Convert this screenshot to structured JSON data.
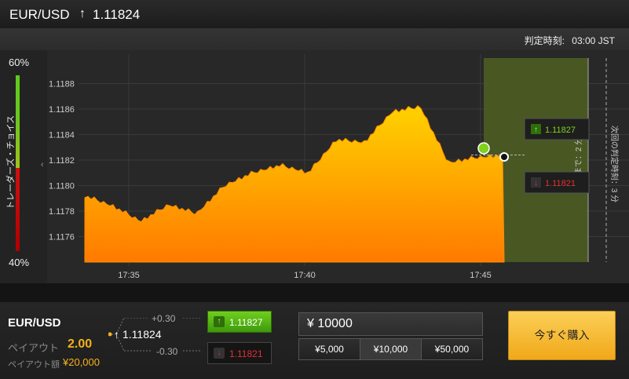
{
  "header": {
    "pair": "EUR/USD",
    "arrow": "↑",
    "price": "1.11824"
  },
  "expiry": {
    "label": "判定時刻:",
    "time": "03:00 JST"
  },
  "traders_choice": {
    "top_pct": "60%",
    "bottom_pct": "40%",
    "label": "トレーダーズ・チョイス",
    "high_fraction": 0.6
  },
  "chart": {
    "y_ticks": [
      "1.1188",
      "1.1186",
      "1.1184",
      "1.1182",
      "1.1180",
      "1.1178",
      "1.1176"
    ],
    "x_ticks": [
      "17:35",
      "17:40",
      "17:45"
    ],
    "high_label": "1.11827",
    "low_label": "1.11821",
    "time_remaining_label": "判定まで：2 分",
    "next_expiry_label": "次回の判定時刻：3 分",
    "colors": {
      "area_top": "#ffd200",
      "area_bottom": "#ff7a00",
      "expiry_zone": "#4b5a23",
      "high": "#7fd11b",
      "low": "#e53030"
    }
  },
  "chart_data": {
    "type": "area",
    "x": [
      "17:32",
      "17:33",
      "17:34",
      "17:35",
      "17:36",
      "17:37",
      "17:38",
      "17:39",
      "17:40",
      "17:41",
      "17:42",
      "17:43",
      "17:44",
      "17:45",
      "17:45:30",
      "17:46"
    ],
    "values": [
      1.11792,
      1.11784,
      1.11772,
      1.11785,
      1.11778,
      1.118,
      1.1181,
      1.11816,
      1.1181,
      1.11836,
      1.11834,
      1.11858,
      1.11862,
      1.11818,
      1.11822,
      1.11824
    ],
    "ylim": [
      1.1174,
      1.119
    ],
    "current": 1.11824
  },
  "bottom": {
    "pair": "EUR/USD",
    "payout_label": "ペイアウト",
    "payout_value": "2.00",
    "payout_amount_label": "ペイアウト額",
    "payout_amount_value": "¥20,000",
    "plus_spread": "+0.30",
    "minus_spread": "-0.30",
    "current_arrow": "↑",
    "current_price": "1.11824",
    "high_button": "1.11827",
    "low_button": "1.11821",
    "amount_value": "¥ 10000",
    "presets": [
      "¥5,000",
      "¥10,000",
      "¥50,000"
    ],
    "buy_label": "今すぐ購入"
  }
}
